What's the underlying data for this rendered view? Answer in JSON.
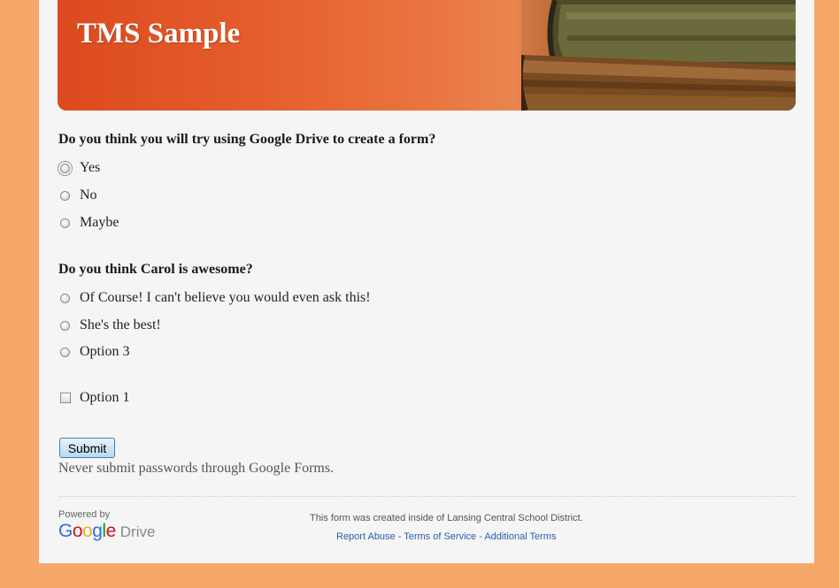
{
  "form": {
    "title": "TMS Sample",
    "q1": {
      "text": "Do you think you will try using Google Drive to create a form?",
      "options": [
        "Yes",
        "No",
        "Maybe"
      ]
    },
    "q2": {
      "text": "Do you think Carol is awesome?",
      "options": [
        "Of Course! I can't believe you would even ask this!",
        "She's the best!",
        "Option 3"
      ]
    },
    "checkbox_option": "Option 1",
    "submit_label": "Submit",
    "warning": "Never submit passwords through Google Forms."
  },
  "footer": {
    "powered_by": "Powered by",
    "logo_letters": [
      "G",
      "o",
      "o",
      "g",
      "l",
      "e"
    ],
    "logo_drive": "Drive",
    "created_note": "This form was created inside of Lansing Central School District.",
    "links": [
      "Report Abuse",
      "Terms of Service",
      "Additional Terms"
    ],
    "separator": " - "
  },
  "colors": {
    "page_background": "#f6a76a",
    "banner_orange": "#e45c2a",
    "link_blue": "#2a5db0",
    "google_letters": [
      "#3369e8",
      "#d50f25",
      "#eeb211",
      "#3369e8",
      "#009925",
      "#d50f25"
    ]
  }
}
